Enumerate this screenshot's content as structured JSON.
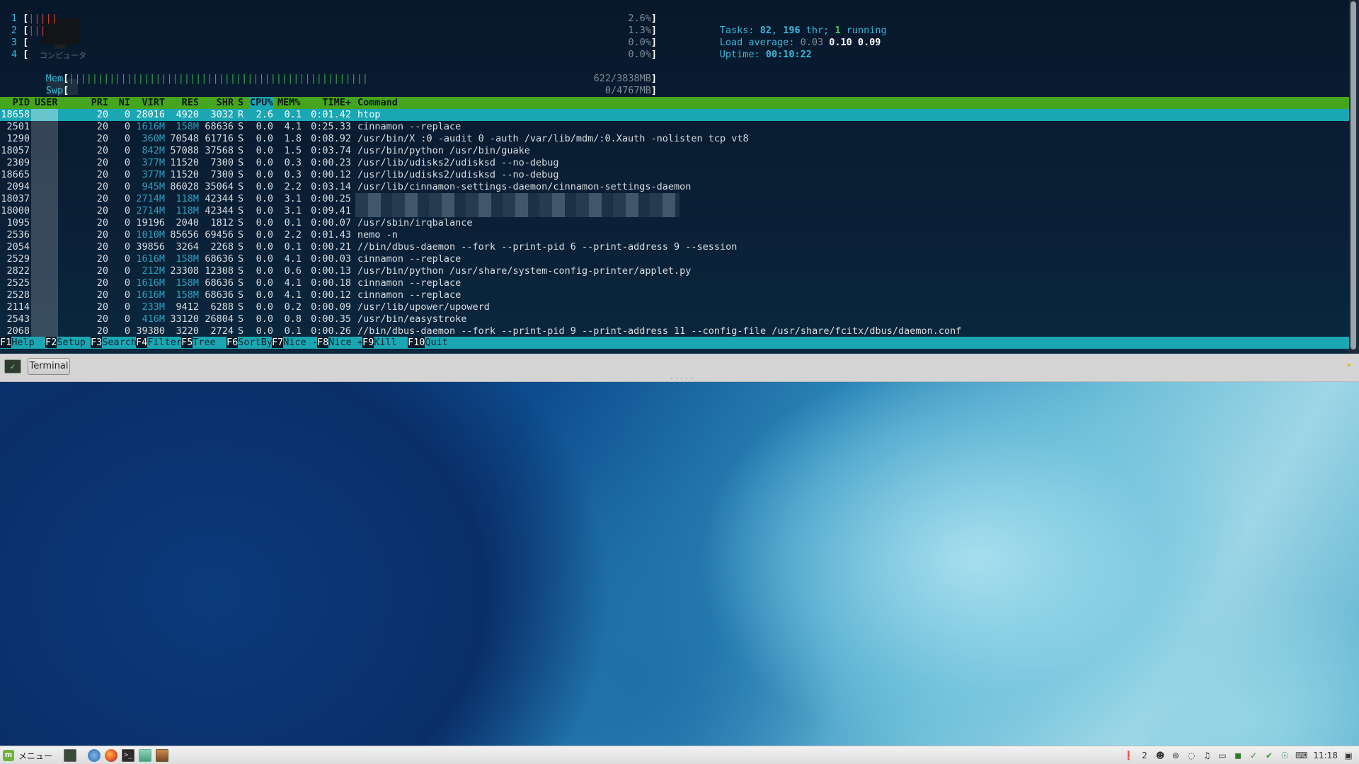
{
  "htop": {
    "cpus": [
      {
        "label": "1",
        "bar": "|||||",
        "pct": "2.6%"
      },
      {
        "label": "2",
        "bar": "|||",
        "pct": "1.3%"
      },
      {
        "label": "3",
        "bar": "",
        "pct": "0.0%"
      },
      {
        "label": "4",
        "bar": "",
        "pct": "0.0%"
      }
    ],
    "mem": {
      "label": "Mem",
      "bar": "||||||||||||||||||||||||||||||||||||||||||||||||||||",
      "value": "622/3838MB"
    },
    "swap": {
      "label": "Swp",
      "value": "0/4767MB"
    },
    "tasks": {
      "label": "Tasks:",
      "count": "82",
      "sep": ",",
      "threads": "196",
      "threads_label": "thr;",
      "running": "1",
      "running_label": "running"
    },
    "load": {
      "label": "Load average:",
      "v1": "0.03",
      "v5": "0.10",
      "v15": "0.09"
    },
    "uptime": {
      "label": "Uptime:",
      "value": "00:10:22"
    },
    "desktop_icon_label": "コンピュータ",
    "headers": {
      "pid": "PID",
      "user": "USER",
      "pri": "PRI",
      "ni": "NI",
      "virt": "VIRT",
      "res": "RES",
      "shr": "SHR",
      "s": "S",
      "cpu": "CPU%",
      "mem": "MEM%",
      "time": "TIME+",
      "cmd": "Command"
    },
    "processes": [
      {
        "pid": "18658",
        "pri": "20",
        "ni": "0",
        "virt": "28016",
        "res": "4920",
        "shr": "3032",
        "s": "R",
        "cpu": "2.6",
        "mem": "0.1",
        "time": "0:01.42",
        "cmd": "htop",
        "selected": true
      },
      {
        "pid": "2501",
        "pri": "20",
        "ni": "0",
        "virt": "1616M",
        "res": "158M",
        "shr": "68636",
        "s": "S",
        "cpu": "0.0",
        "mem": "4.1",
        "time": "0:25.33",
        "cmd": "cinnamon --replace"
      },
      {
        "pid": "1290",
        "pri": "20",
        "ni": "0",
        "virt": "360M",
        "res": "70548",
        "shr": "61716",
        "s": "S",
        "cpu": "0.0",
        "mem": "1.8",
        "time": "0:08.92",
        "cmd": "/usr/bin/X :0 -audit 0 -auth /var/lib/mdm/:0.Xauth -nolisten tcp vt8"
      },
      {
        "pid": "18057",
        "pri": "20",
        "ni": "0",
        "virt": "842M",
        "res": "57088",
        "shr": "37568",
        "s": "S",
        "cpu": "0.0",
        "mem": "1.5",
        "time": "0:03.74",
        "cmd": "/usr/bin/python /usr/bin/guake"
      },
      {
        "pid": "2309",
        "pri": "20",
        "ni": "0",
        "virt": "377M",
        "res": "11520",
        "shr": "7300",
        "s": "S",
        "cpu": "0.0",
        "mem": "0.3",
        "time": "0:00.23",
        "cmd": "/usr/lib/udisks2/udisksd --no-debug"
      },
      {
        "pid": "18665",
        "pri": "20",
        "ni": "0",
        "virt": "377M",
        "res": "11520",
        "shr": "7300",
        "s": "S",
        "cpu": "0.0",
        "mem": "0.3",
        "time": "0:00.12",
        "cmd": "/usr/lib/udisks2/udisksd --no-debug"
      },
      {
        "pid": "2094",
        "pri": "20",
        "ni": "0",
        "virt": "945M",
        "res": "86028",
        "shr": "35064",
        "s": "S",
        "cpu": "0.0",
        "mem": "2.2",
        "time": "0:03.14",
        "cmd": "/usr/lib/cinnamon-settings-daemon/cinnamon-settings-daemon"
      },
      {
        "pid": "18037",
        "pri": "20",
        "ni": "0",
        "virt": "2714M",
        "res": "118M",
        "shr": "42344",
        "s": "S",
        "cpu": "0.0",
        "mem": "3.1",
        "time": "0:00.25",
        "cmd": "",
        "redacted": true
      },
      {
        "pid": "18000",
        "pri": "20",
        "ni": "0",
        "virt": "2714M",
        "res": "118M",
        "shr": "42344",
        "s": "S",
        "cpu": "0.0",
        "mem": "3.1",
        "time": "0:09.41",
        "cmd": "",
        "redacted": true
      },
      {
        "pid": "1095",
        "pri": "20",
        "ni": "0",
        "virt": "19196",
        "res": "2040",
        "shr": "1812",
        "s": "S",
        "cpu": "0.0",
        "mem": "0.1",
        "time": "0:00.07",
        "cmd": "/usr/sbin/irqbalance"
      },
      {
        "pid": "2536",
        "pri": "20",
        "ni": "0",
        "virt": "1010M",
        "res": "85656",
        "shr": "69456",
        "s": "S",
        "cpu": "0.0",
        "mem": "2.2",
        "time": "0:01.43",
        "cmd": "nemo -n"
      },
      {
        "pid": "2054",
        "pri": "20",
        "ni": "0",
        "virt": "39856",
        "res": "3264",
        "shr": "2268",
        "s": "S",
        "cpu": "0.0",
        "mem": "0.1",
        "time": "0:00.21",
        "cmd": "//bin/dbus-daemon --fork --print-pid 6 --print-address 9 --session"
      },
      {
        "pid": "2529",
        "pri": "20",
        "ni": "0",
        "virt": "1616M",
        "res": "158M",
        "shr": "68636",
        "s": "S",
        "cpu": "0.0",
        "mem": "4.1",
        "time": "0:00.03",
        "cmd": "cinnamon --replace"
      },
      {
        "pid": "2822",
        "pri": "20",
        "ni": "0",
        "virt": "212M",
        "res": "23308",
        "shr": "12308",
        "s": "S",
        "cpu": "0.0",
        "mem": "0.6",
        "time": "0:00.13",
        "cmd": "/usr/bin/python /usr/share/system-config-printer/applet.py"
      },
      {
        "pid": "2525",
        "pri": "20",
        "ni": "0",
        "virt": "1616M",
        "res": "158M",
        "shr": "68636",
        "s": "S",
        "cpu": "0.0",
        "mem": "4.1",
        "time": "0:00.18",
        "cmd": "cinnamon --replace"
      },
      {
        "pid": "2528",
        "pri": "20",
        "ni": "0",
        "virt": "1616M",
        "res": "158M",
        "shr": "68636",
        "s": "S",
        "cpu": "0.0",
        "mem": "4.1",
        "time": "0:00.12",
        "cmd": "cinnamon --replace"
      },
      {
        "pid": "2114",
        "pri": "20",
        "ni": "0",
        "virt": "233M",
        "res": "9412",
        "shr": "6288",
        "s": "S",
        "cpu": "0.0",
        "mem": "0.2",
        "time": "0:00.09",
        "cmd": "/usr/lib/upower/upowerd"
      },
      {
        "pid": "2543",
        "pri": "20",
        "ni": "0",
        "virt": "416M",
        "res": "33120",
        "shr": "26804",
        "s": "S",
        "cpu": "0.0",
        "mem": "0.8",
        "time": "0:00.35",
        "cmd": "/usr/bin/easystroke"
      },
      {
        "pid": "2068",
        "pri": "20",
        "ni": "0",
        "virt": "39380",
        "res": "3220",
        "shr": "2724",
        "s": "S",
        "cpu": "0.0",
        "mem": "0.1",
        "time": "0:00.26",
        "cmd": "//bin/dbus-daemon --fork --print-pid 9 --print-address 11 --config-file /usr/share/fcitx/dbus/daemon.conf"
      }
    ],
    "fkeys": [
      {
        "key": "F1",
        "label": "Help"
      },
      {
        "key": "F2",
        "label": "Setup"
      },
      {
        "key": "F3",
        "label": "Search"
      },
      {
        "key": "F4",
        "label": "Filter"
      },
      {
        "key": "F5",
        "label": "Tree"
      },
      {
        "key": "F6",
        "label": "SortBy"
      },
      {
        "key": "F7",
        "label": "Nice -"
      },
      {
        "key": "F8",
        "label": "Nice +"
      },
      {
        "key": "F9",
        "label": "Kill"
      },
      {
        "key": "F10",
        "label": "Quit"
      }
    ]
  },
  "terminal_tab": {
    "label": "Terminal"
  },
  "panel": {
    "menu_label": "メニュー",
    "tray_count": "2",
    "clock": "11:18"
  },
  "colors": {
    "header_green": "#46a51e",
    "selected_cyan": "#1aa7b3",
    "label_cyan": "#37b8d8"
  }
}
